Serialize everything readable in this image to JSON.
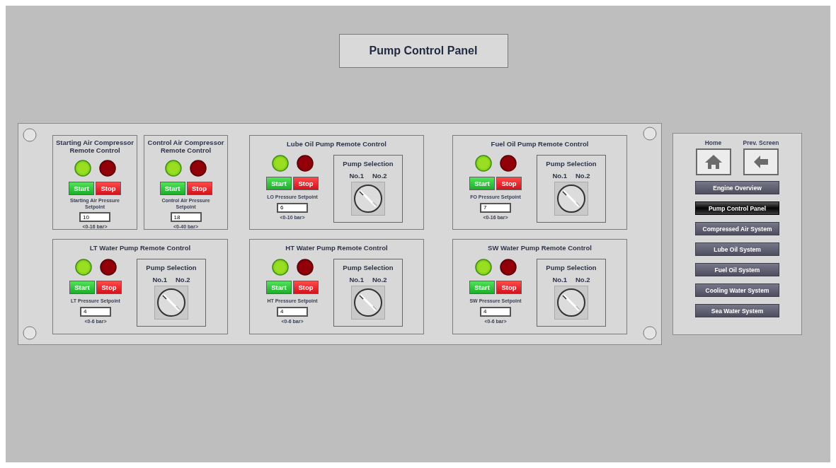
{
  "title": "Pump Control Panel",
  "units": [
    {
      "kind": "compressor",
      "title": "Starting Air Compressor Remote Control",
      "start": "Start",
      "stop": "Stop",
      "setpoint_label": "Starting Air Pressure Setpoint",
      "setpoint": "10",
      "range": "<0-16 bar>"
    },
    {
      "kind": "compressor",
      "title": "Control Air Compressor Remote Control",
      "start": "Start",
      "stop": "Stop",
      "setpoint_label": "Control Air Pressure Setpoint",
      "setpoint": "18",
      "range": "<0-40 bar>"
    },
    {
      "kind": "pump",
      "title": "Lube Oil Pump Remote Control",
      "start": "Start",
      "stop": "Stop",
      "setpoint_label": "LO Pressure Setpoint",
      "setpoint": "6",
      "range": "<0-10 bar>",
      "selection_title": "Pump Selection",
      "options": [
        {
          "label": "No.1",
          "selected": true
        },
        {
          "label": "No.2",
          "selected": false
        }
      ]
    },
    {
      "kind": "pump",
      "title": "Fuel Oil Pump Remote Control",
      "start": "Start",
      "stop": "Stop",
      "setpoint_label": "FO Pressure Setpoint",
      "setpoint": "7",
      "range": "<0-16 bar>",
      "selection_title": "Pump Selection",
      "options": [
        {
          "label": "No.1",
          "selected": true
        },
        {
          "label": "No.2",
          "selected": false
        }
      ]
    },
    {
      "kind": "pump",
      "title": "LT Water Pump Remote Control",
      "start": "Start",
      "stop": "Stop",
      "setpoint_label": "LT Pressure Setpoint",
      "setpoint": "4",
      "range": "<0-6 bar>",
      "selection_title": "Pump Selection",
      "options": [
        {
          "label": "No.1",
          "selected": true
        },
        {
          "label": "No.2",
          "selected": false
        }
      ]
    },
    {
      "kind": "pump",
      "title": "HT Water Pump Remote Control",
      "start": "Start",
      "stop": "Stop",
      "setpoint_label": "HT Pressure Setpoint",
      "setpoint": "4",
      "range": "<0-6 bar>",
      "selection_title": "Pump Selection",
      "options": [
        {
          "label": "No.1",
          "selected": true
        },
        {
          "label": "No.2",
          "selected": false
        }
      ]
    },
    {
      "kind": "pump",
      "title": "SW Water Pump Remote Control",
      "start": "Start",
      "stop": "Stop",
      "setpoint_label": "SW Pressure Setpoint",
      "setpoint": "4",
      "range": "<0-6 bar>",
      "selection_title": "Pump Selection",
      "options": [
        {
          "label": "No.1",
          "selected": true
        },
        {
          "label": "No.2",
          "selected": false
        }
      ]
    }
  ],
  "navigation": {
    "home_label": "Home",
    "prev_label": "Prev. Screen",
    "items": [
      {
        "label": "Engine Overview",
        "selected": false
      },
      {
        "label": "Pump Control Panel",
        "selected": true
      },
      {
        "label": "Compressed Air System",
        "selected": false
      },
      {
        "label": "Lube Oil System",
        "selected": false
      },
      {
        "label": "Fuel Oil System",
        "selected": false
      },
      {
        "label": "Cooling Water System",
        "selected": false
      },
      {
        "label": "Sea Water System",
        "selected": false
      }
    ]
  }
}
